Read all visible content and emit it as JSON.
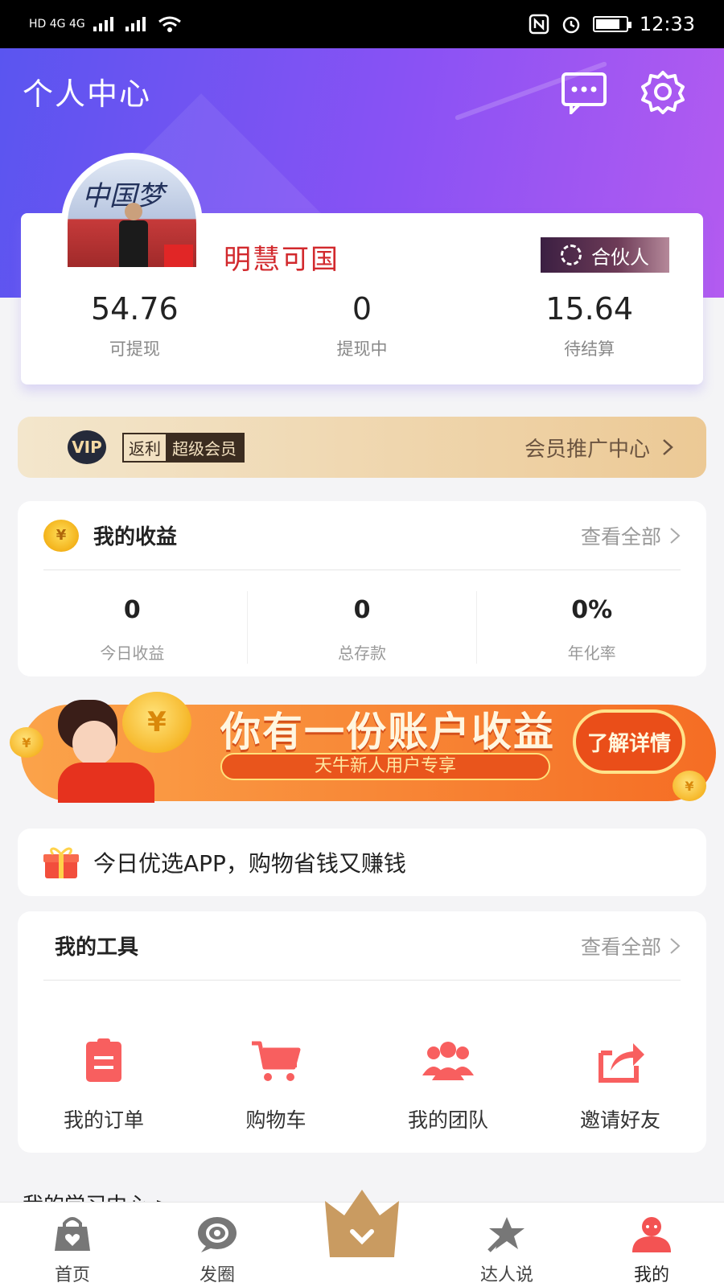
{
  "status_bar": {
    "time": "12:33",
    "left": "HD 4G 4G",
    "battery_percent": 80
  },
  "header": {
    "title": "个人中心"
  },
  "profile": {
    "name": "明慧可国",
    "badge": "合伙人",
    "avatar_text": "中国梦",
    "stats": [
      {
        "value": "54.76",
        "label": "可提现"
      },
      {
        "value": "0",
        "label": "提现中"
      },
      {
        "value": "15.64",
        "label": "待结算"
      }
    ]
  },
  "vip": {
    "logo": "VIP",
    "tag_left": "返利",
    "tag_right": "超级会员",
    "link": "会员推广中心"
  },
  "earnings": {
    "title": "我的收益",
    "more": "查看全部",
    "items": [
      {
        "value": "0",
        "label": "今日收益"
      },
      {
        "value": "0",
        "label": "总存款"
      },
      {
        "value": "0%",
        "label": "年化率"
      }
    ]
  },
  "promo": {
    "title": "你有一份账户收益",
    "subtitle": "天牛新人用户专享",
    "button": "了解详情",
    "coin_symbol": "¥"
  },
  "notice": {
    "text": "今日优选APP，购物省钱又赚钱"
  },
  "tools": {
    "title": "我的工具",
    "more": "查看全部",
    "items": [
      {
        "label": "我的订单",
        "icon": "order-icon"
      },
      {
        "label": "购物车",
        "icon": "cart-icon"
      },
      {
        "label": "我的团队",
        "icon": "team-icon"
      },
      {
        "label": "邀请好友",
        "icon": "share-icon"
      }
    ]
  },
  "partial_section": {
    "text": "我的学习中心 >"
  },
  "tabs": [
    {
      "label": "首页",
      "icon": "bag-icon"
    },
    {
      "label": "发圈",
      "icon": "circle-icon"
    },
    {
      "label": "",
      "icon": "crown-icon"
    },
    {
      "label": "达人说",
      "icon": "star-icon"
    },
    {
      "label": "我的",
      "icon": "user-icon"
    }
  ],
  "colors": {
    "accent": "#8a52f4",
    "name_red": "#d2292d",
    "tool_icon": "#f85f5f",
    "promo_orange": "#f56d24"
  }
}
